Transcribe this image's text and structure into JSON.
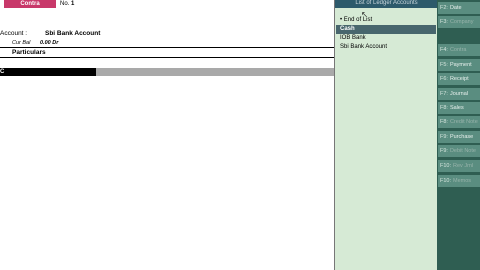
{
  "voucher": {
    "type": "Contra",
    "no_label": "No.",
    "no_value": "1",
    "account_label": "Account :",
    "account_value": "Sbi Bank Account",
    "current_balance_label": "Cur Bal",
    "current_balance_value": "0.00 Dr",
    "particulars_label": "Particulars",
    "entry_prefix": "C"
  },
  "ledger_list": {
    "title": "List of Ledger Accounts",
    "items": [
      {
        "label": "End of List",
        "selected": false
      },
      {
        "label": "Cash",
        "selected": true
      },
      {
        "label": "IOB Bank",
        "selected": false
      },
      {
        "label": "Sbi Bank Account",
        "selected": false
      }
    ]
  },
  "button_bar": {
    "buttons": [
      {
        "key": "F2:",
        "label": "Date",
        "enabled": true
      },
      {
        "key": "F3:",
        "label": "Company",
        "enabled": false
      },
      {
        "key": "F4:",
        "label": "Contra",
        "enabled": false
      },
      {
        "key": "F5:",
        "label": "Payment",
        "enabled": true
      },
      {
        "key": "F6:",
        "label": "Receipt",
        "enabled": true
      },
      {
        "key": "F7:",
        "label": "Journal",
        "enabled": true
      },
      {
        "key": "F8:",
        "label": "Sales",
        "enabled": true
      },
      {
        "key": "F8:",
        "label": "Credit Note",
        "enabled": false
      },
      {
        "key": "F9:",
        "label": "Purchase",
        "enabled": true
      },
      {
        "key": "F9:",
        "label": "Debit Note",
        "enabled": false
      },
      {
        "key": "F10:",
        "label": "Rev Jrnl",
        "enabled": false
      },
      {
        "key": "F10:",
        "label": "Memos",
        "enabled": false
      }
    ]
  },
  "colors": {
    "voucher_badge": "#c8386a",
    "ledger_panel_bg": "#d6ead5",
    "ledger_selection": "#48666d",
    "button_bar_bg": "#2f5e52",
    "button_bg": "#5a8d80"
  }
}
